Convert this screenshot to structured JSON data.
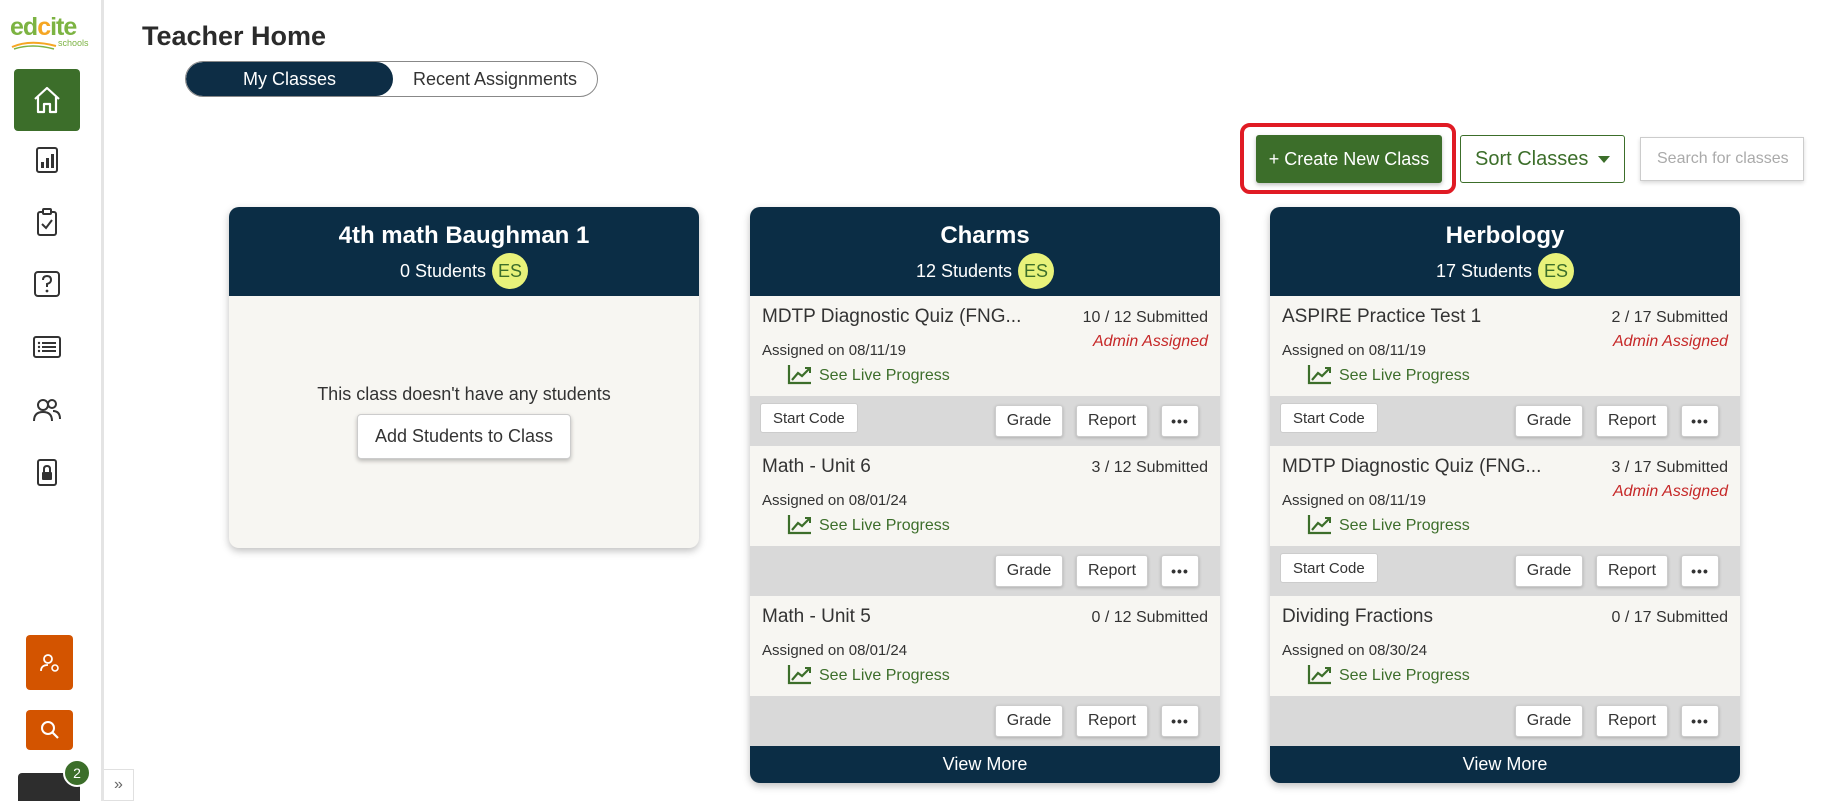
{
  "logo": {
    "word_e": "ed",
    "word_c": "c",
    "word_rest": "ite",
    "sub": "schools"
  },
  "sidebar": {
    "items": [
      {
        "name": "home",
        "icon": "home-icon",
        "active": true
      },
      {
        "name": "reports",
        "icon": "bar-chart-icon",
        "active": false
      },
      {
        "name": "assignments",
        "icon": "clipboard-check-icon",
        "active": false
      },
      {
        "name": "questions",
        "icon": "question-icon",
        "active": false
      },
      {
        "name": "lists",
        "icon": "list-icon",
        "active": false
      },
      {
        "name": "classes",
        "icon": "users-icon",
        "active": false
      },
      {
        "name": "locked",
        "icon": "lock-icon",
        "active": false
      }
    ],
    "notification_count": "2",
    "collapse_glyph": "»"
  },
  "header": {
    "title": "Teacher Home",
    "tabs": [
      {
        "label": "My Classes",
        "active": true
      },
      {
        "label": "Recent Assignments",
        "active": false
      }
    ]
  },
  "toolbar": {
    "create_label": "+ Create New Class",
    "sort_label": "Sort Classes",
    "search_placeholder": "Search for classes"
  },
  "classes": [
    {
      "title": "4th math Baughman 1",
      "students": "0 Students",
      "badge": "ES",
      "empty_text": "This class doesn't have any students",
      "add_students_label": "Add Students to Class"
    },
    {
      "title": "Charms",
      "students": "12 Students",
      "badge": "ES",
      "assignments": [
        {
          "name": "MDTP Diagnostic Quiz (FNG...",
          "submitted": "10 / 12 Submitted",
          "admin": "Admin Assigned",
          "assigned": "Assigned on 08/11/19",
          "live": "See Live Progress",
          "start_code": "Start Code"
        },
        {
          "name": "Math - Unit 6",
          "submitted": "3 / 12 Submitted",
          "admin": "",
          "assigned": "Assigned on 08/01/24",
          "live": "See Live Progress",
          "start_code": ""
        },
        {
          "name": "Math - Unit 5",
          "submitted": "0 / 12 Submitted",
          "admin": "",
          "assigned": "Assigned on 08/01/24",
          "live": "See Live Progress",
          "start_code": ""
        }
      ],
      "view_more": "View More"
    },
    {
      "title": "Herbology",
      "students": "17 Students",
      "badge": "ES",
      "assignments": [
        {
          "name": "ASPIRE Practice Test 1",
          "submitted": "2 / 17 Submitted",
          "admin": "Admin Assigned",
          "assigned": "Assigned on 08/11/19",
          "live": "See Live Progress",
          "start_code": "Start Code"
        },
        {
          "name": "MDTP Diagnostic Quiz (FNG...",
          "submitted": "3 / 17 Submitted",
          "admin": "Admin Assigned",
          "assigned": "Assigned on 08/11/19",
          "live": "See Live Progress",
          "start_code": "Start Code"
        },
        {
          "name": "Dividing Fractions",
          "submitted": "0 / 17 Submitted",
          "admin": "",
          "assigned": "Assigned on 08/30/24",
          "live": "See Live Progress",
          "start_code": ""
        }
      ],
      "view_more": "View More"
    }
  ],
  "actions": {
    "grade": "Grade",
    "report": "Report",
    "more": "•••"
  },
  "colors": {
    "brand_green": "#3c6e2a",
    "navy": "#0b2d45",
    "orange": "#d35400",
    "highlight_red": "#e01b24",
    "badge_yellow": "#e8f27a"
  }
}
